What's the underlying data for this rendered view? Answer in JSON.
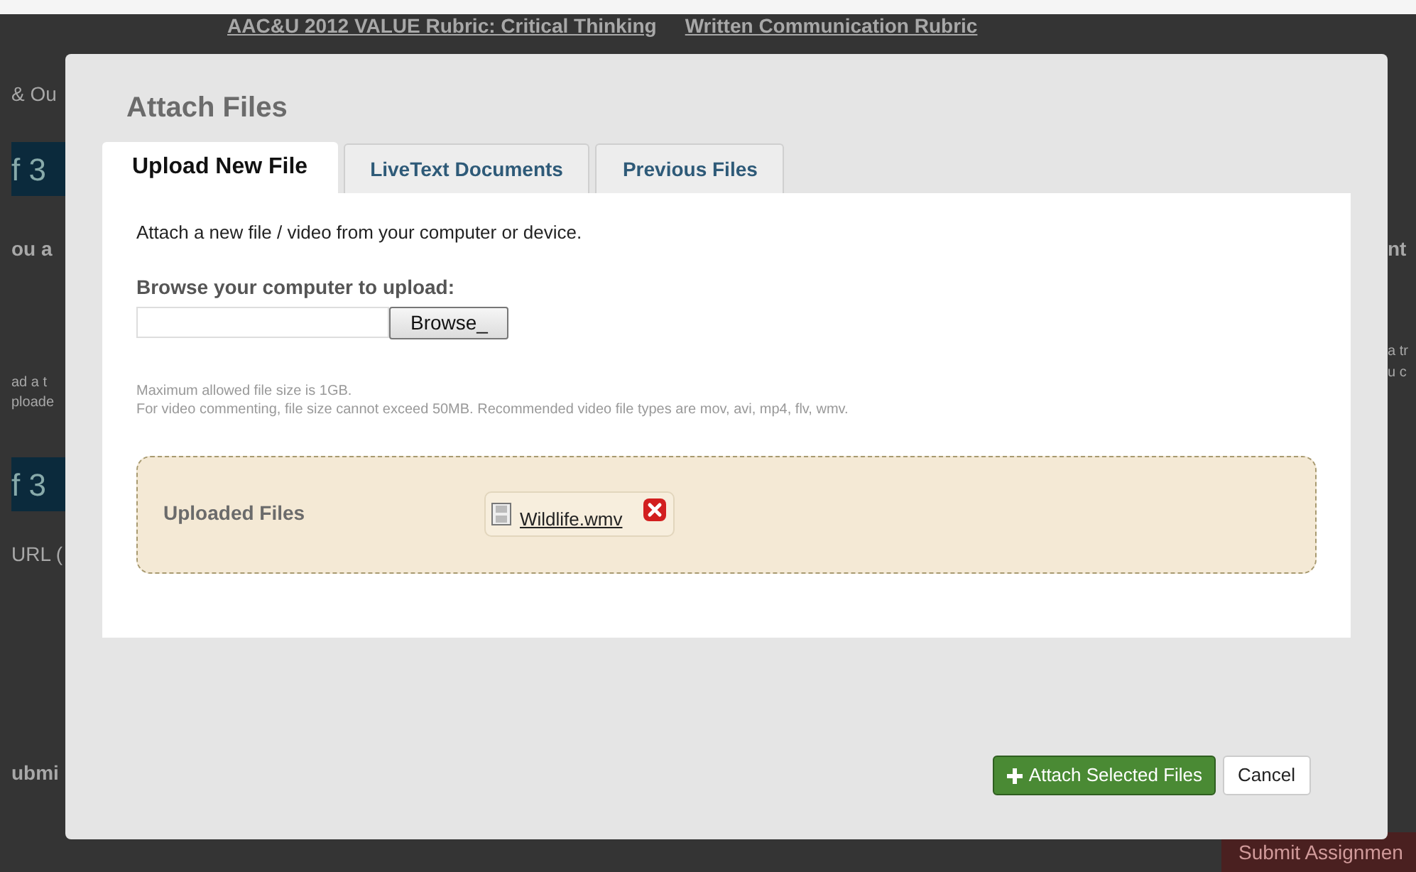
{
  "background": {
    "links": [
      "AAC&U 2012 VALUE Rubric: Critical Thinking",
      "Written Communication Rubric"
    ],
    "fragments": [
      {
        "text": "& Ou",
        "kind": "plain"
      },
      {
        "text": "f 3",
        "kind": "header"
      },
      {
        "text": "ou a",
        "kind": "bold"
      },
      {
        "text": "ad a t",
        "kind": "small"
      },
      {
        "text": "ploade",
        "kind": "small"
      },
      {
        "text": "f 3",
        "kind": "header"
      },
      {
        "text": "URL (",
        "kind": "plain"
      },
      {
        "text": "ubmi",
        "kind": "bold"
      }
    ],
    "right_fragments": [
      {
        "text": "nt",
        "kind": "bold"
      },
      {
        "text": "a tr",
        "kind": "small"
      },
      {
        "text": "u c",
        "kind": "small"
      }
    ],
    "submit_button": "Submit Assignmen"
  },
  "dialog": {
    "title": "Attach Files",
    "tabs": [
      {
        "label": "Upload New File",
        "selected": true
      },
      {
        "label": "LiveText Documents",
        "selected": false
      },
      {
        "label": "Previous Files",
        "selected": false
      }
    ],
    "intro": "Attach a new file / video from your computer or device.",
    "browse_label": "Browse your computer to upload:",
    "browse_button": "Browse_",
    "notes": [
      "Maximum allowed file size is 1GB.",
      "For video commenting, file size cannot exceed 50MB. Recommended video file types are mov, avi, mp4, flv, wmv."
    ],
    "uploaded": {
      "label": "Uploaded Files",
      "files": [
        {
          "name": "Wildlife.wmv"
        }
      ]
    },
    "buttons": [
      {
        "label": "Attach Selected Files",
        "kind": "primary"
      },
      {
        "label": "Cancel",
        "kind": "secondary"
      }
    ]
  }
}
